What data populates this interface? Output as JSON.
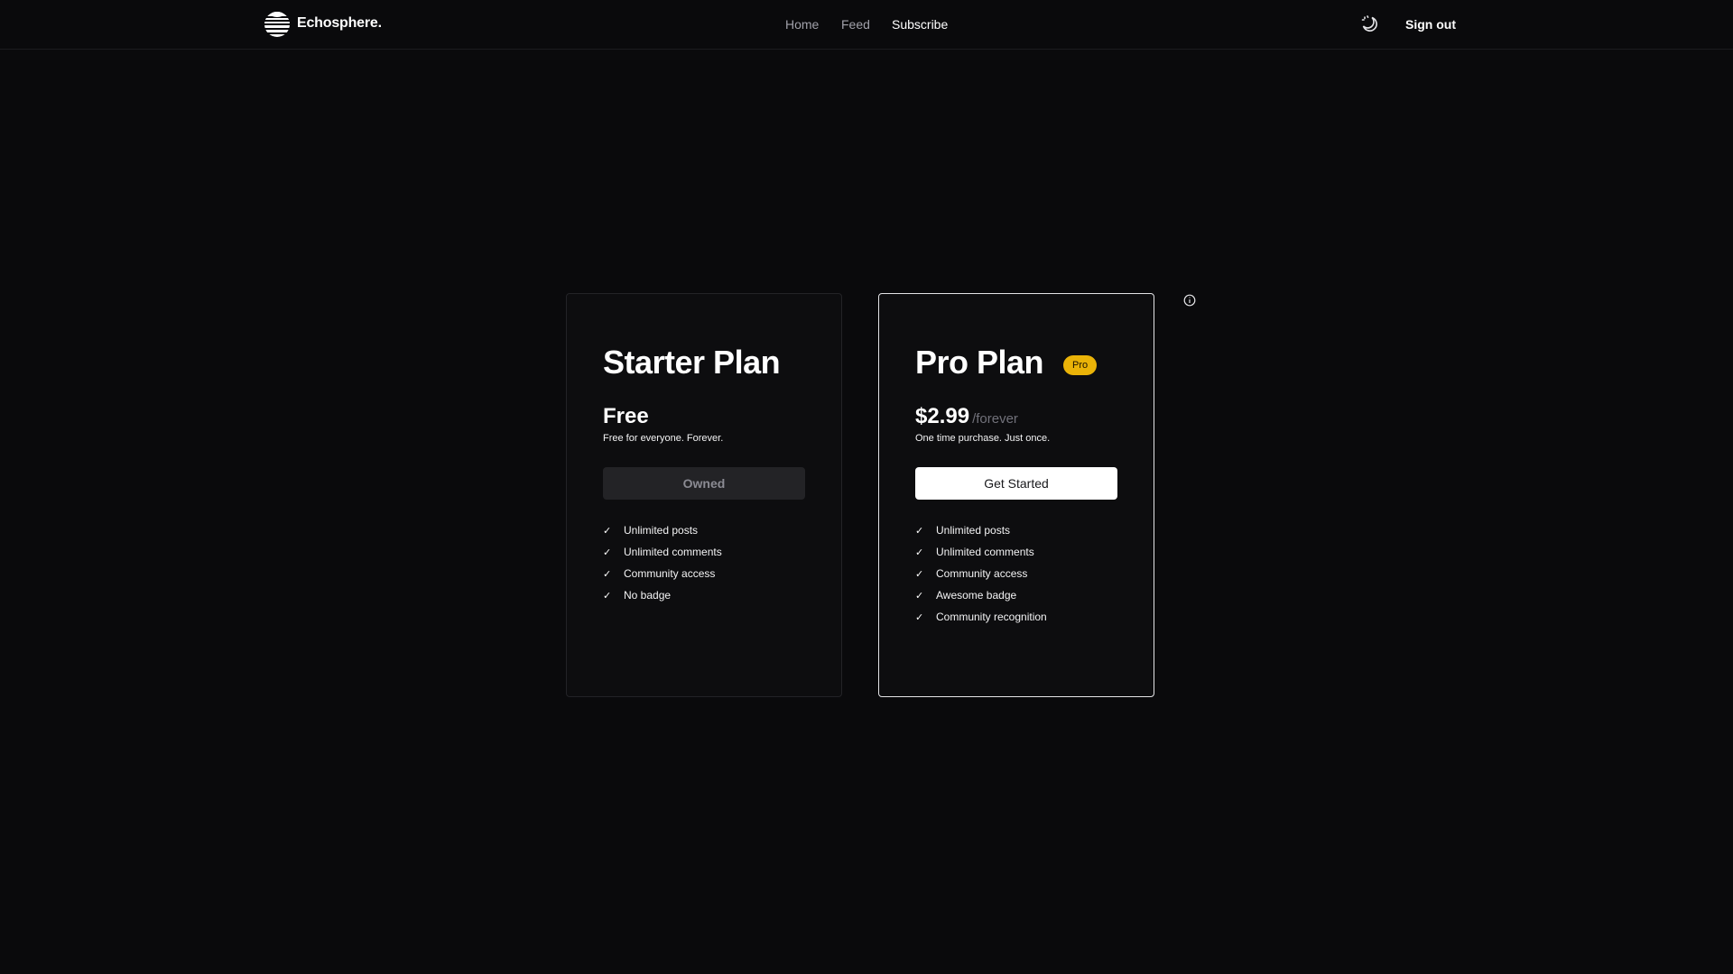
{
  "header": {
    "brand": "Echosphere.",
    "nav": [
      {
        "label": "Home",
        "active": false
      },
      {
        "label": "Feed",
        "active": false
      },
      {
        "label": "Subscribe",
        "active": true
      }
    ],
    "theme_icon": "moon-sun-icon",
    "sign_out": "Sign out"
  },
  "plans": {
    "starter": {
      "title": "Starter Plan",
      "price": "Free",
      "description": "Free for everyone. Forever.",
      "button": "Owned",
      "features": [
        "Unlimited posts",
        "Unlimited comments",
        "Community access",
        "No badge"
      ]
    },
    "pro": {
      "title": "Pro Plan",
      "badge": "Pro",
      "price": "$2.99",
      "period": "/forever",
      "description": "One time purchase. Just once.",
      "button": "Get Started",
      "features": [
        "Unlimited posts",
        "Unlimited comments",
        "Community access",
        "Awesome badge",
        "Community recognition"
      ]
    }
  },
  "icons": {
    "check": "✓",
    "info": "info-icon"
  },
  "colors": {
    "background": "#0a0a0c",
    "pro_badge": "#eab308",
    "cta_button": "#ffffff"
  }
}
